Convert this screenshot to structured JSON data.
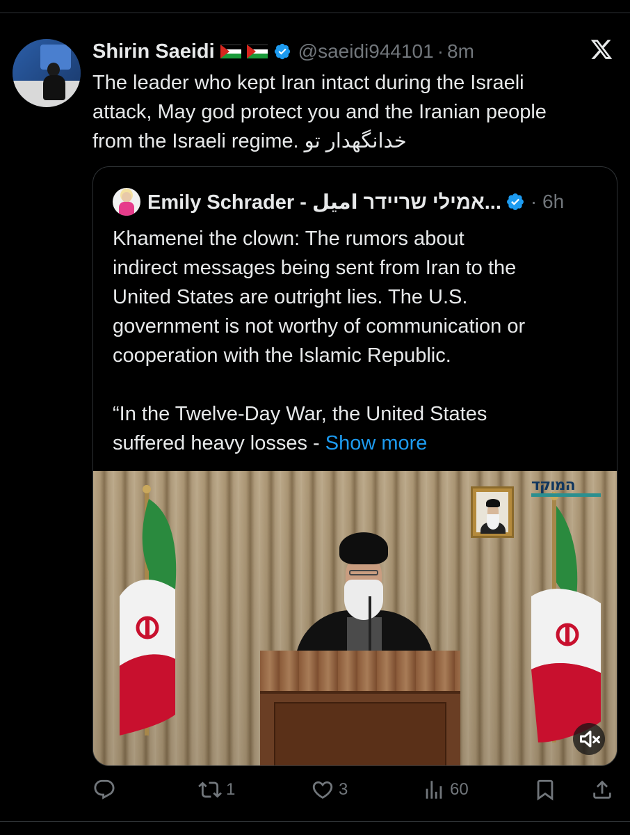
{
  "tweet": {
    "author_name": "Shirin Saeidi",
    "handle": "@saeidi944101",
    "separator": "·",
    "time": "8m",
    "text_lines": [
      "The leader who kept Iran intact during the Israeli",
      "attack, May god protect you and the Iranian people",
      "from the Israeli regime. خدانگهدار تو"
    ],
    "icons": [
      "palestine-flag-icon",
      "verified-badge-icon",
      "x-logo-icon"
    ]
  },
  "quoted": {
    "author_name": "Emily Schrader - אמילי שריידר اميل...",
    "separator": "·",
    "time": "6h",
    "text_lines": [
      "Khamenei the clown: The  rumors about",
      "indirect messages being sent from Iran to the",
      "United States are outright lies. The U.S.",
      "government is not worthy of communication or",
      "cooperation with the Islamic Republic."
    ],
    "text_lines_2": [
      "“In the Twelve-Day War, the United States",
      "suffered heavy losses - "
    ],
    "show_more": "Show more",
    "media": {
      "logo_text": "המוקד",
      "icons": [
        "mute-icon"
      ]
    }
  },
  "actions": {
    "reply_count": "",
    "retweet_count": "1",
    "like_count": "3",
    "views_count": "60"
  },
  "colors": {
    "background": "#000000",
    "text": "#e7e9ea",
    "muted": "#71767b",
    "link": "#1d9bf0",
    "verified": "#1d9bf0",
    "border": "#2f3336"
  }
}
